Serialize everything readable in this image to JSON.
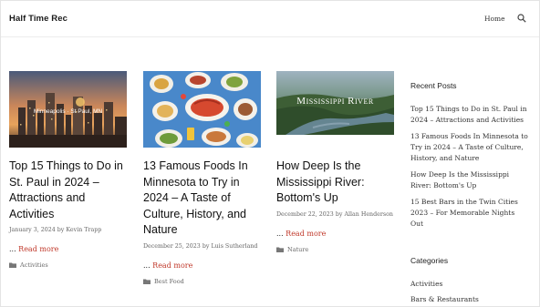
{
  "header": {
    "site_title": "Half Time Rec",
    "nav_home": "Home"
  },
  "posts": [
    {
      "image_caption": "Minneapolis · St Paul, MN",
      "title": "Top 15 Things to Do in St. Paul in 2024 – Attractions and Activities",
      "date": "January 3, 2024",
      "by": "by",
      "author": "Kevin Trapp",
      "more_prefix": "... ",
      "more_label": "Read more",
      "category": "Activities"
    },
    {
      "title": "13 Famous Foods In Minnesota to Try in 2024 – A Taste of Culture, History, and Nature",
      "date": "December 25, 2023",
      "by": "by",
      "author": "Luis Sutherland",
      "more_prefix": "... ",
      "more_label": "Read more",
      "category": "Best Food"
    },
    {
      "image_caption": "Mississippi River",
      "title": "How Deep Is the Mississippi River: Bottom's Up",
      "date": "December 22, 2023",
      "by": "by",
      "author": "Allan Henderson",
      "more_prefix": "... ",
      "more_label": "Read more",
      "category": "Nature"
    }
  ],
  "sidebar": {
    "recent_heading": "Recent Posts",
    "recent": [
      "Top 15 Things to Do in St. Paul in 2024 – Attractions and Activities",
      "13 Famous Foods In Minnesota to Try in 2024 – A Taste of Culture, History, and Nature",
      "How Deep Is the Mississippi River: Bottom's Up",
      "15 Best Bars in the Twin Cities 2023 – For Memorable Nights Out"
    ],
    "categories_heading": "Categories",
    "categories": [
      "Activities",
      "Bars & Restaurants"
    ]
  },
  "colors": {
    "link_red": "#c0392b",
    "text": "#222222"
  }
}
